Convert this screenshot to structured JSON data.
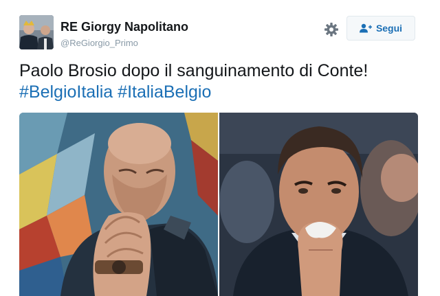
{
  "tweet": {
    "author": {
      "display_name": "RE Giorgy Napolitano",
      "handle": "@ReGiorgio_Primo",
      "avatar_icon": "avatar-photo"
    },
    "actions": {
      "settings_icon": "gear-icon",
      "follow_icon": "add-user-icon",
      "follow_label": "Segui"
    },
    "text_line_1": "Paolo Brosio dopo il sanguinamento di Conte!",
    "hashtags": [
      "#BelgioItalia",
      "#ItaliaBelgio"
    ],
    "media": [
      {
        "icon": "photo-man-praying"
      },
      {
        "icon": "photo-man-with-tissue-on-nose"
      }
    ]
  },
  "colors": {
    "link": "#1b6fb5",
    "text": "#14171a",
    "muted": "#8899a6",
    "button_border": "#e1e8ed",
    "button_bg": "#f5f8fa"
  }
}
